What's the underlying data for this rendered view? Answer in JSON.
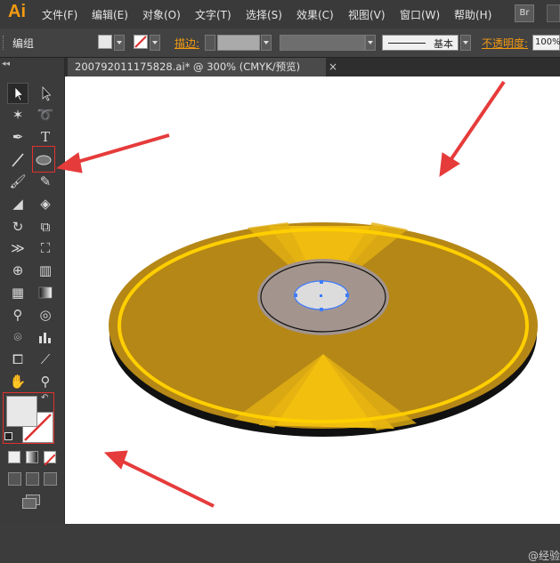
{
  "app": {
    "logo": "Ai"
  },
  "menu": [
    "文件(F)",
    "编辑(E)",
    "对象(O)",
    "文字(T)",
    "选择(S)",
    "效果(C)",
    "视图(V)",
    "窗口(W)",
    "帮助(H)"
  ],
  "menu_extra": {
    "bridge": "Br"
  },
  "control_bar": {
    "selection_label": "编组",
    "stroke_label": "描边:",
    "brush_label": "基本",
    "opacity_label": "不透明度:",
    "opacity_value": "100%"
  },
  "document_tab": {
    "title": "200792011175828.ai* @ 300% (CMYK/预览)",
    "close": "×"
  },
  "watermark": "@经验",
  "colors": {
    "disc_gold": "#b8860b",
    "disc_highlight": "#ffcf00",
    "hub_gray": "#a3958e",
    "hole_fill": "#dcdcdc",
    "selection_blue": "#3d7bff",
    "arrow_red": "#e63b3b",
    "orange_label": "#f39a12"
  },
  "icons": [
    "selection-tool-icon",
    "direct-selection-tool-icon",
    "magic-wand-icon",
    "lasso-icon",
    "pen-icon",
    "type-icon",
    "line-tool-icon",
    "ellipse-tool-icon",
    "paintbrush-icon",
    "pencil-icon",
    "blob-brush-icon",
    "eraser-icon",
    "rotate-icon",
    "scale-icon",
    "width-tool-icon",
    "free-transform-icon",
    "shape-builder-icon",
    "perspective-grid-icon",
    "mesh-icon",
    "gradient-icon",
    "eyedropper-icon",
    "blend-icon",
    "symbol-sprayer-icon",
    "graph-icon",
    "artboard-icon",
    "slice-icon",
    "hand-icon",
    "zoom-icon"
  ]
}
